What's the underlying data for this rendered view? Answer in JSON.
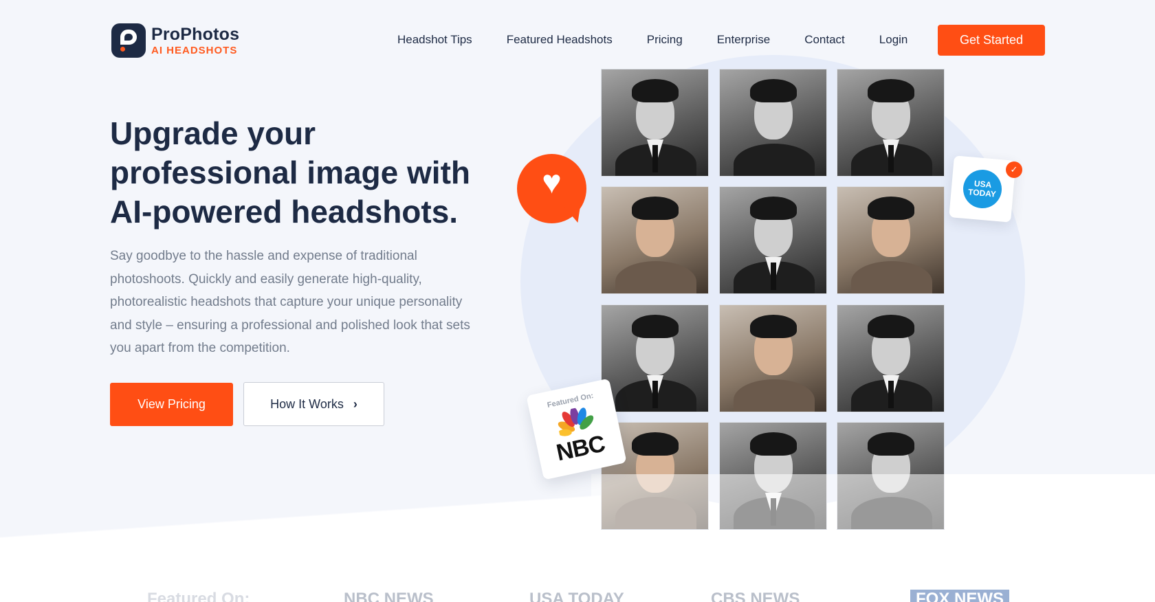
{
  "brand": {
    "name": "ProPhotos",
    "tagline": "AI HEADSHOTS"
  },
  "nav": {
    "items": [
      "Headshot Tips",
      "Featured Headshots",
      "Pricing",
      "Enterprise",
      "Contact",
      "Login"
    ],
    "cta": "Get Started"
  },
  "hero": {
    "headline": "Upgrade your professional image with AI-powered headshots.",
    "subtext": "Say goodbye to the hassle and expense of traditional photoshoots. Quickly and easily generate high-quality, photorealistic headshots that capture your unique personality and style – ensuring a professional and polished look that sets you apart from the competition.",
    "primary_button": "View Pricing",
    "secondary_button": "How It Works"
  },
  "badges": {
    "usa_today": "USA TODAY",
    "nbc_label": "Featured On:",
    "nbc": "NBC"
  },
  "featured_strip": {
    "label": "Featured On:",
    "logos": [
      "NBC NEWS",
      "USA TODAY",
      "CBS NEWS",
      "FOX NEWS"
    ]
  },
  "colors": {
    "accent": "#ff4e14",
    "navy": "#1d2a44",
    "usa_blue": "#1a9be3"
  }
}
